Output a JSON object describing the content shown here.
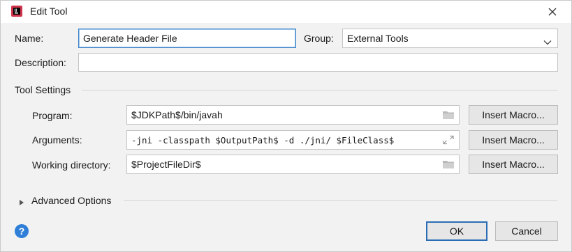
{
  "window": {
    "title": "Edit Tool"
  },
  "form": {
    "name_label": "Name:",
    "name_value": "Generate Header File",
    "group_label": "Group:",
    "group_value": "External Tools",
    "description_label": "Description:",
    "description_value": ""
  },
  "tool_settings": {
    "title": "Tool Settings",
    "program_label": "Program:",
    "program_value": "$JDKPath$/bin/javah",
    "arguments_label": "Arguments:",
    "arguments_value": "-jni -classpath $OutputPath$ -d ./jni/ $FileClass$",
    "working_dir_label": "Working directory:",
    "working_dir_value": "$ProjectFileDir$",
    "insert_macro_label": "Insert Macro..."
  },
  "advanced": {
    "title": "Advanced Options"
  },
  "footer": {
    "ok_label": "OK",
    "cancel_label": "Cancel",
    "help_glyph": "?"
  },
  "colors": {
    "accent": "#2f7fd8",
    "focus_border": "#3d84c8",
    "primary_border": "#2a6db5",
    "app_icon": "#d0344c"
  },
  "icons": {
    "app": "intellij-app-icon",
    "close": "close-icon",
    "dropdown": "chevron-down-icon",
    "folder": "folder-icon",
    "expand": "expand-icon",
    "disclosure": "triangle-right-icon",
    "help": "help-icon"
  }
}
